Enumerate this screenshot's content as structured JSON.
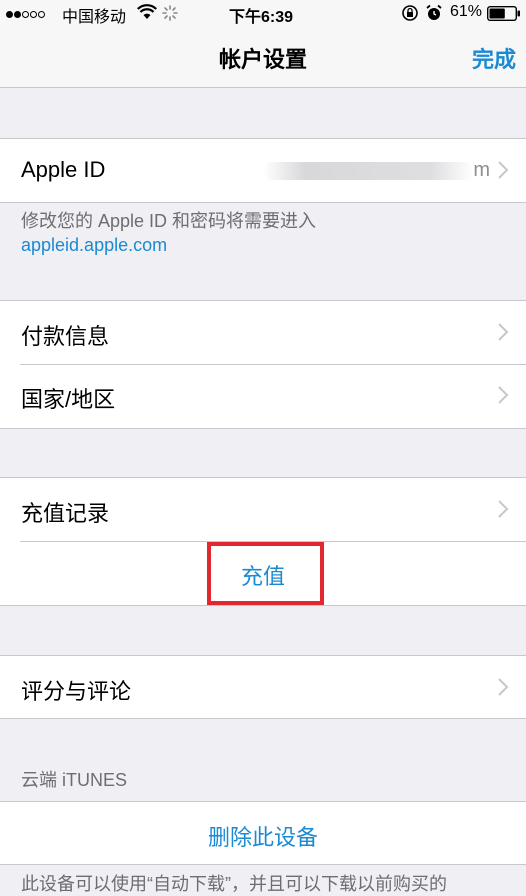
{
  "status_bar": {
    "carrier": "中国移动",
    "time": "下午6:39",
    "battery_percent": "61%",
    "battery_level": 0.61
  },
  "nav": {
    "title": "帐户设置",
    "done_label": "完成"
  },
  "apple_id": {
    "label": "Apple ID",
    "value_suffix": "m",
    "note_line1": "修改您的 Apple ID 和密码将需要进入",
    "note_link": "appleid.apple.com"
  },
  "payment": {
    "payment_info": "付款信息",
    "region": "国家/地区"
  },
  "topup": {
    "history": "充值记录",
    "action": "充值"
  },
  "ratings": {
    "label": "评分与评论"
  },
  "cloud": {
    "header": "云端 iTUNES",
    "remove_device": "删除此设备",
    "note": "此设备可以使用“自动下载”，并且可以下载以前购买的"
  }
}
